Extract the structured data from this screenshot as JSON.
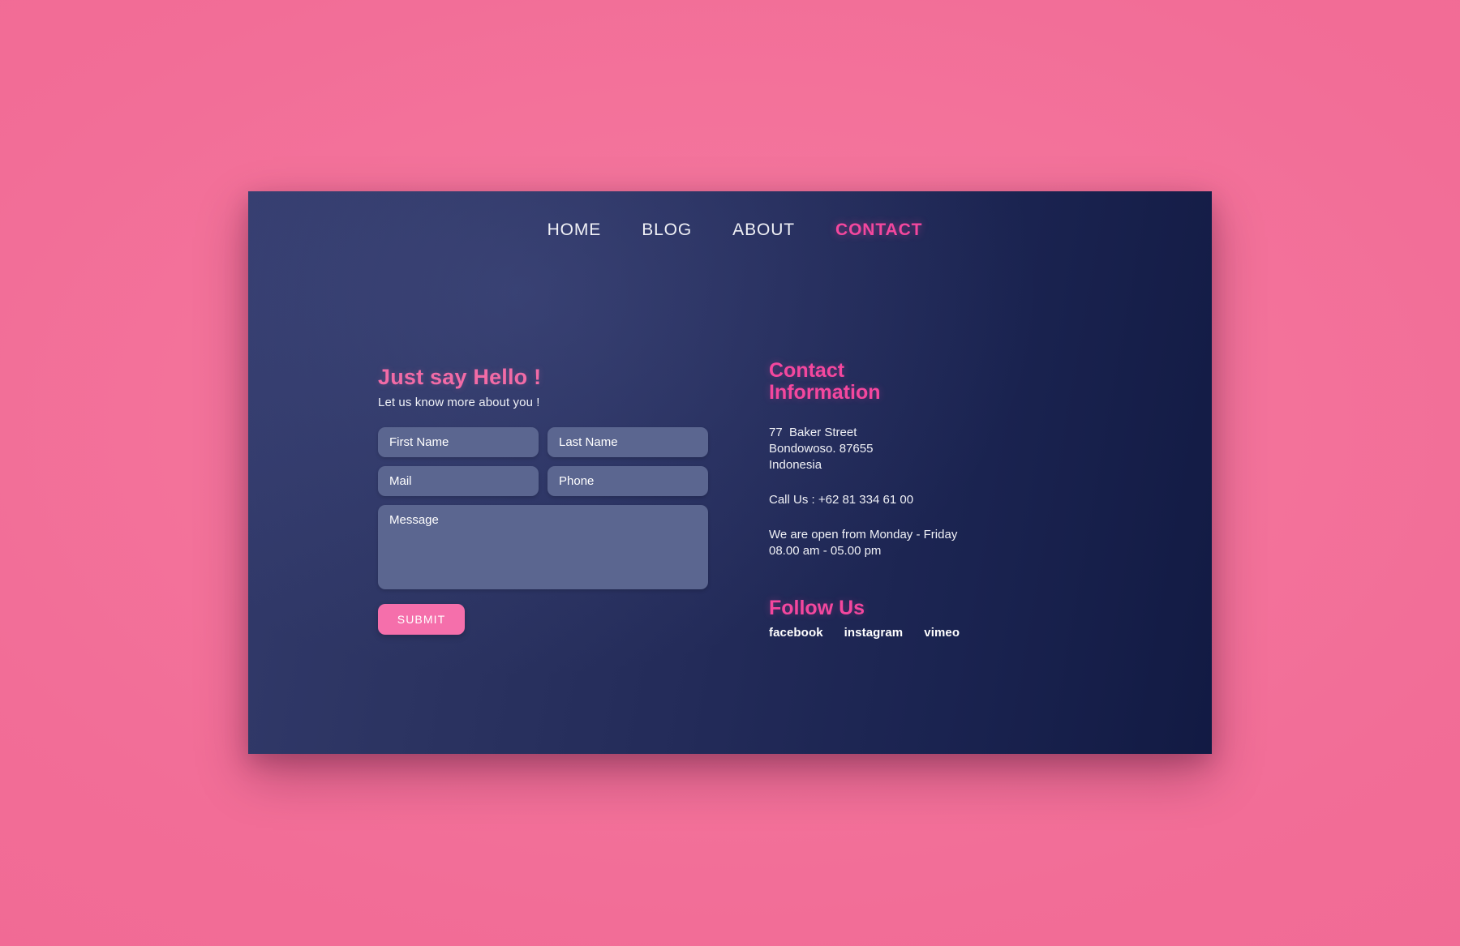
{
  "theme": {
    "page_background": "#f26d97",
    "card_gradient_from": "#323a6b",
    "card_gradient_to": "#121a43",
    "accent_pink": "#f4479e",
    "heading_pink": "#f26ba6",
    "field_background": "#5b6690",
    "button_pink": "#f56fab",
    "text_light": "#f0f1f6"
  },
  "nav": {
    "items": [
      {
        "label": "HOME",
        "active": false
      },
      {
        "label": "BLOG",
        "active": false
      },
      {
        "label": "ABOUT",
        "active": false
      },
      {
        "label": "CONTACT",
        "active": true
      }
    ]
  },
  "form": {
    "title": "Just say Hello !",
    "subtitle": "Let us know more about you !",
    "fields": {
      "first_name": {
        "placeholder": "First Name",
        "value": ""
      },
      "last_name": {
        "placeholder": "Last Name",
        "value": ""
      },
      "mail": {
        "placeholder": "Mail",
        "value": ""
      },
      "phone": {
        "placeholder": "Phone",
        "value": ""
      },
      "message": {
        "placeholder": "Message",
        "value": ""
      }
    },
    "submit_label": "SUBMIT"
  },
  "contact": {
    "title_line1": "Contact",
    "title_line2": "Information",
    "address": {
      "line1": "77  Baker Street",
      "line2": "Bondowoso. 87655",
      "line3": "Indonesia"
    },
    "phone_line": "Call Us : +62 81 334 61 00",
    "hours": {
      "line1": "We are open from Monday - Friday",
      "line2": "08.00 am - 05.00 pm"
    }
  },
  "follow": {
    "title": "Follow Us",
    "links": [
      {
        "label": "facebook"
      },
      {
        "label": "instagram"
      },
      {
        "label": "vimeo"
      }
    ]
  }
}
